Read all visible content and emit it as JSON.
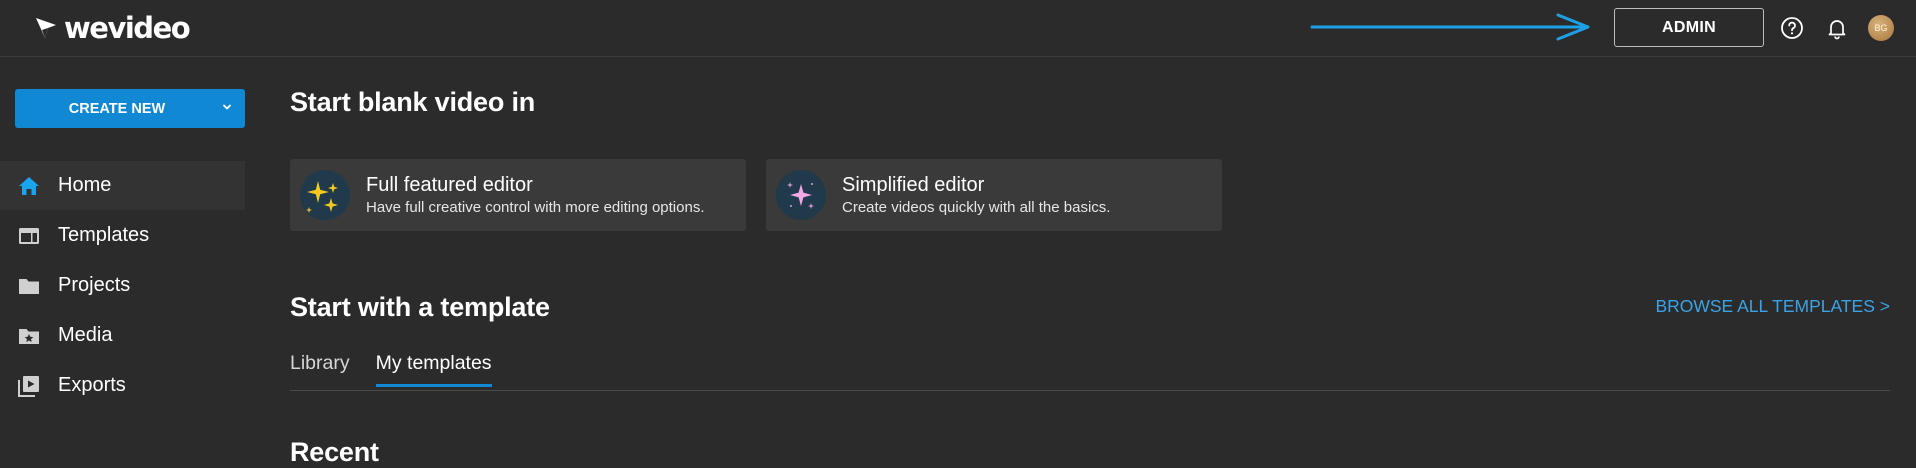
{
  "header": {
    "logo_text": "wevideo",
    "admin_label": "ADMIN",
    "avatar_initials": "BG",
    "icons": [
      "help-icon",
      "bell-icon"
    ],
    "annotation_arrow_color": "#1ea0e6"
  },
  "sidebar": {
    "create_label": "CREATE NEW",
    "items": [
      {
        "label": "Home",
        "icon": "home-icon",
        "active": true
      },
      {
        "label": "Templates",
        "icon": "templates-icon"
      },
      {
        "label": "Projects",
        "icon": "folder-icon"
      },
      {
        "label": "Media",
        "icon": "media-icon"
      },
      {
        "label": "Exports",
        "icon": "exports-icon"
      }
    ]
  },
  "main": {
    "blank_title": "Start blank video in",
    "editors": [
      {
        "title": "Full featured editor",
        "desc": "Have full creative control with more editing options.",
        "icon": "sparkles-icon"
      },
      {
        "title": "Simplified editor",
        "desc": "Create videos quickly with all the basics.",
        "icon": "sparkle-icon"
      }
    ],
    "template_title": "Start with a template",
    "browse_label": "BROWSE ALL TEMPLATES >",
    "tabs": [
      {
        "label": "Library"
      },
      {
        "label": "My templates",
        "active": true
      }
    ],
    "recent_title": "Recent"
  },
  "colors": {
    "accent": "#1188d4",
    "link": "#3aa3e6",
    "background": "#2b2b2b"
  }
}
